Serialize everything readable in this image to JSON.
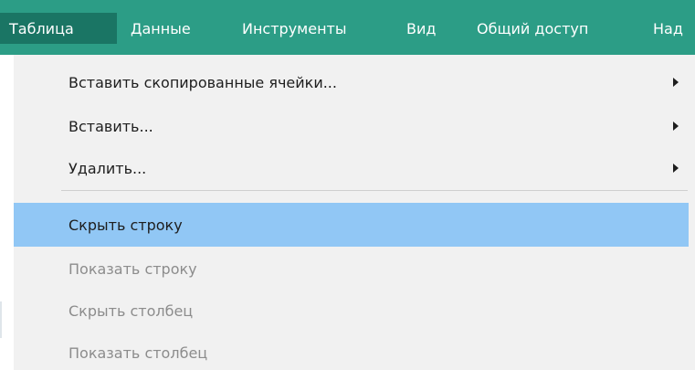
{
  "menubar": {
    "items": [
      {
        "label": "Таблица",
        "active": true
      },
      {
        "label": "Данные",
        "active": false
      },
      {
        "label": "Инструменты",
        "active": false
      },
      {
        "label": "Вид",
        "active": false
      },
      {
        "label": "Общий доступ",
        "active": false
      },
      {
        "label": "Над",
        "active": false
      }
    ]
  },
  "dropdown": {
    "items": [
      {
        "label": "Вставить скопированные ячейки...",
        "submenu": true,
        "enabled": true
      },
      {
        "label": "Вставить...",
        "submenu": true,
        "enabled": true
      },
      {
        "label": "Удалить...",
        "submenu": true,
        "enabled": true
      },
      {
        "label": "Скрыть строку",
        "submenu": false,
        "enabled": true,
        "highlighted": true
      },
      {
        "label": "Показать строку",
        "submenu": false,
        "enabled": false
      },
      {
        "label": "Скрыть столбец",
        "submenu": false,
        "enabled": false
      },
      {
        "label": "Показать столбец",
        "submenu": false,
        "enabled": false
      }
    ]
  },
  "colors": {
    "menubar_bg": "#2c9d86",
    "menubar_active_bg": "#1a7564",
    "dropdown_bg": "#f1f1f1",
    "highlight_bg": "#91c7f5",
    "disabled_text": "#8c8c8c"
  },
  "icons": {
    "submenu_arrow": "caret-right-icon"
  }
}
